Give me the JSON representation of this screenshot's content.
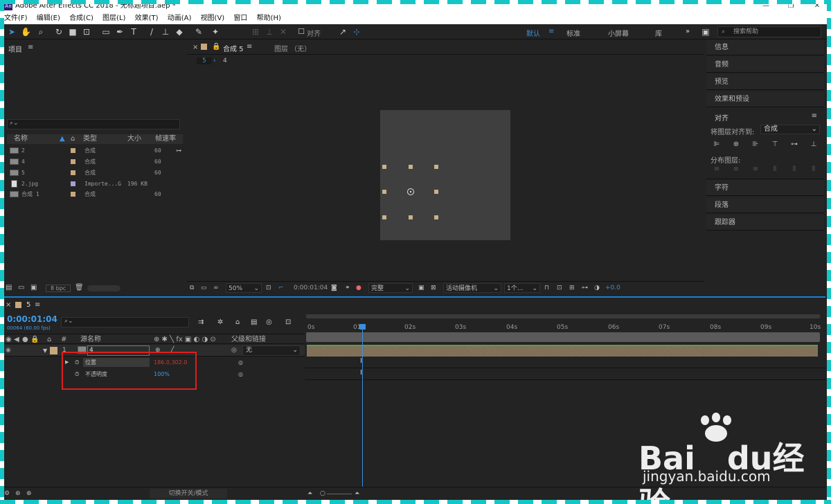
{
  "window": {
    "title": "Adobe After Effects CC 2018 - 无标题项目.aep *",
    "logo": "Ae",
    "min": "—",
    "max": "❐",
    "close": "✕"
  },
  "menu": [
    "文件(F)",
    "编辑(E)",
    "合成(C)",
    "图层(L)",
    "效果(T)",
    "动画(A)",
    "视图(V)",
    "窗口",
    "帮助(H)"
  ],
  "toolbar": {
    "align_label": "对齐",
    "workspaces": [
      {
        "label": "默认",
        "active": true
      },
      {
        "label": "标准",
        "active": false
      },
      {
        "label": "小屏幕",
        "active": false
      },
      {
        "label": "库",
        "active": false
      }
    ],
    "more": "»",
    "search_placeholder": "搜索帮助"
  },
  "project": {
    "title": "项目",
    "menu_icon": "≡",
    "search_placeholder": "",
    "columns": [
      "名称",
      "类型",
      "大小",
      "帧速率"
    ],
    "items": [
      {
        "name": "2",
        "type": "合成",
        "size": "",
        "fps": "60",
        "label_color": "#c9a77d"
      },
      {
        "name": "4",
        "type": "合成",
        "size": "",
        "fps": "60",
        "label_color": "#c9a77d"
      },
      {
        "name": "5",
        "type": "合成",
        "size": "",
        "fps": "60",
        "label_color": "#c9a77d"
      },
      {
        "name": "2.jpg",
        "type": "Importe...G",
        "size": "196 KB",
        "fps": "",
        "label_color": "#a5a0d8"
      },
      {
        "name": "合成 1",
        "type": "合成",
        "size": "",
        "fps": "60",
        "label_color": "#c9a77d"
      }
    ],
    "bpc": "8 bpc"
  },
  "viewer": {
    "tab_label": "合成 5",
    "layer_tab": "图层 （无）",
    "breadcrumb": [
      "5",
      "4"
    ],
    "zoom": "50%",
    "timecode": "0:00:01:04",
    "quality": "完整",
    "camera": "活动摄像机",
    "views": "1个...",
    "exposure": "+0.0"
  },
  "right_panels": {
    "items_top": [
      "信息",
      "音频",
      "预览",
      "效果和预设"
    ],
    "align": {
      "title": "对齐",
      "align_to_label": "将图层对齐到:",
      "align_to_value": "合成",
      "distribute_label": "分布图层:"
    },
    "items_bottom": [
      "字符",
      "段落",
      "跟踪器"
    ]
  },
  "timeline": {
    "comp_tab": "5",
    "timecode": "0:00:01:04",
    "fps_info": "00064 (60.00 fps)",
    "columns": {
      "num": "#",
      "source": "源名称",
      "parent": "父级和链接"
    },
    "layer": {
      "index": "1",
      "name": "4",
      "parent": "无"
    },
    "properties": [
      {
        "name": "位置",
        "value": "186.0,302.0",
        "value_color": "#d0392b"
      },
      {
        "name": "不透明度",
        "value": "100%",
        "value_color": "#3f9ae6"
      }
    ],
    "ruler_ticks": [
      "0s",
      "01s",
      "02s",
      "03s",
      "04s",
      "05s",
      "06s",
      "07s",
      "08s",
      "09s",
      "10s"
    ],
    "footer_label": "切换开关/模式"
  },
  "watermark": {
    "brand": "Bai",
    "brand2": "du",
    "cn": "经验",
    "url": "jingyan.baidu.com"
  }
}
